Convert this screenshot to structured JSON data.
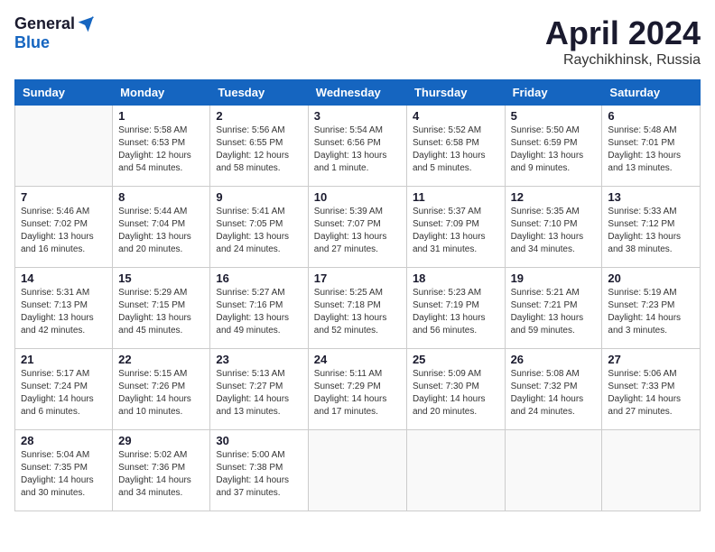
{
  "logo": {
    "general": "General",
    "blue": "Blue"
  },
  "title": "April 2024",
  "location": "Raychikhinsk, Russia",
  "days_of_week": [
    "Sunday",
    "Monday",
    "Tuesday",
    "Wednesday",
    "Thursday",
    "Friday",
    "Saturday"
  ],
  "weeks": [
    [
      {
        "num": "",
        "sunrise": "",
        "sunset": "",
        "daylight": "",
        "empty": true
      },
      {
        "num": "1",
        "sunrise": "Sunrise: 5:58 AM",
        "sunset": "Sunset: 6:53 PM",
        "daylight": "Daylight: 12 hours and 54 minutes."
      },
      {
        "num": "2",
        "sunrise": "Sunrise: 5:56 AM",
        "sunset": "Sunset: 6:55 PM",
        "daylight": "Daylight: 12 hours and 58 minutes."
      },
      {
        "num": "3",
        "sunrise": "Sunrise: 5:54 AM",
        "sunset": "Sunset: 6:56 PM",
        "daylight": "Daylight: 13 hours and 1 minute."
      },
      {
        "num": "4",
        "sunrise": "Sunrise: 5:52 AM",
        "sunset": "Sunset: 6:58 PM",
        "daylight": "Daylight: 13 hours and 5 minutes."
      },
      {
        "num": "5",
        "sunrise": "Sunrise: 5:50 AM",
        "sunset": "Sunset: 6:59 PM",
        "daylight": "Daylight: 13 hours and 9 minutes."
      },
      {
        "num": "6",
        "sunrise": "Sunrise: 5:48 AM",
        "sunset": "Sunset: 7:01 PM",
        "daylight": "Daylight: 13 hours and 13 minutes."
      }
    ],
    [
      {
        "num": "7",
        "sunrise": "Sunrise: 5:46 AM",
        "sunset": "Sunset: 7:02 PM",
        "daylight": "Daylight: 13 hours and 16 minutes."
      },
      {
        "num": "8",
        "sunrise": "Sunrise: 5:44 AM",
        "sunset": "Sunset: 7:04 PM",
        "daylight": "Daylight: 13 hours and 20 minutes."
      },
      {
        "num": "9",
        "sunrise": "Sunrise: 5:41 AM",
        "sunset": "Sunset: 7:05 PM",
        "daylight": "Daylight: 13 hours and 24 minutes."
      },
      {
        "num": "10",
        "sunrise": "Sunrise: 5:39 AM",
        "sunset": "Sunset: 7:07 PM",
        "daylight": "Daylight: 13 hours and 27 minutes."
      },
      {
        "num": "11",
        "sunrise": "Sunrise: 5:37 AM",
        "sunset": "Sunset: 7:09 PM",
        "daylight": "Daylight: 13 hours and 31 minutes."
      },
      {
        "num": "12",
        "sunrise": "Sunrise: 5:35 AM",
        "sunset": "Sunset: 7:10 PM",
        "daylight": "Daylight: 13 hours and 34 minutes."
      },
      {
        "num": "13",
        "sunrise": "Sunrise: 5:33 AM",
        "sunset": "Sunset: 7:12 PM",
        "daylight": "Daylight: 13 hours and 38 minutes."
      }
    ],
    [
      {
        "num": "14",
        "sunrise": "Sunrise: 5:31 AM",
        "sunset": "Sunset: 7:13 PM",
        "daylight": "Daylight: 13 hours and 42 minutes."
      },
      {
        "num": "15",
        "sunrise": "Sunrise: 5:29 AM",
        "sunset": "Sunset: 7:15 PM",
        "daylight": "Daylight: 13 hours and 45 minutes."
      },
      {
        "num": "16",
        "sunrise": "Sunrise: 5:27 AM",
        "sunset": "Sunset: 7:16 PM",
        "daylight": "Daylight: 13 hours and 49 minutes."
      },
      {
        "num": "17",
        "sunrise": "Sunrise: 5:25 AM",
        "sunset": "Sunset: 7:18 PM",
        "daylight": "Daylight: 13 hours and 52 minutes."
      },
      {
        "num": "18",
        "sunrise": "Sunrise: 5:23 AM",
        "sunset": "Sunset: 7:19 PM",
        "daylight": "Daylight: 13 hours and 56 minutes."
      },
      {
        "num": "19",
        "sunrise": "Sunrise: 5:21 AM",
        "sunset": "Sunset: 7:21 PM",
        "daylight": "Daylight: 13 hours and 59 minutes."
      },
      {
        "num": "20",
        "sunrise": "Sunrise: 5:19 AM",
        "sunset": "Sunset: 7:23 PM",
        "daylight": "Daylight: 14 hours and 3 minutes."
      }
    ],
    [
      {
        "num": "21",
        "sunrise": "Sunrise: 5:17 AM",
        "sunset": "Sunset: 7:24 PM",
        "daylight": "Daylight: 14 hours and 6 minutes."
      },
      {
        "num": "22",
        "sunrise": "Sunrise: 5:15 AM",
        "sunset": "Sunset: 7:26 PM",
        "daylight": "Daylight: 14 hours and 10 minutes."
      },
      {
        "num": "23",
        "sunrise": "Sunrise: 5:13 AM",
        "sunset": "Sunset: 7:27 PM",
        "daylight": "Daylight: 14 hours and 13 minutes."
      },
      {
        "num": "24",
        "sunrise": "Sunrise: 5:11 AM",
        "sunset": "Sunset: 7:29 PM",
        "daylight": "Daylight: 14 hours and 17 minutes."
      },
      {
        "num": "25",
        "sunrise": "Sunrise: 5:09 AM",
        "sunset": "Sunset: 7:30 PM",
        "daylight": "Daylight: 14 hours and 20 minutes."
      },
      {
        "num": "26",
        "sunrise": "Sunrise: 5:08 AM",
        "sunset": "Sunset: 7:32 PM",
        "daylight": "Daylight: 14 hours and 24 minutes."
      },
      {
        "num": "27",
        "sunrise": "Sunrise: 5:06 AM",
        "sunset": "Sunset: 7:33 PM",
        "daylight": "Daylight: 14 hours and 27 minutes."
      }
    ],
    [
      {
        "num": "28",
        "sunrise": "Sunrise: 5:04 AM",
        "sunset": "Sunset: 7:35 PM",
        "daylight": "Daylight: 14 hours and 30 minutes."
      },
      {
        "num": "29",
        "sunrise": "Sunrise: 5:02 AM",
        "sunset": "Sunset: 7:36 PM",
        "daylight": "Daylight: 14 hours and 34 minutes."
      },
      {
        "num": "30",
        "sunrise": "Sunrise: 5:00 AM",
        "sunset": "Sunset: 7:38 PM",
        "daylight": "Daylight: 14 hours and 37 minutes."
      },
      {
        "num": "",
        "sunrise": "",
        "sunset": "",
        "daylight": "",
        "empty": true
      },
      {
        "num": "",
        "sunrise": "",
        "sunset": "",
        "daylight": "",
        "empty": true
      },
      {
        "num": "",
        "sunrise": "",
        "sunset": "",
        "daylight": "",
        "empty": true
      },
      {
        "num": "",
        "sunrise": "",
        "sunset": "",
        "daylight": "",
        "empty": true
      }
    ]
  ]
}
